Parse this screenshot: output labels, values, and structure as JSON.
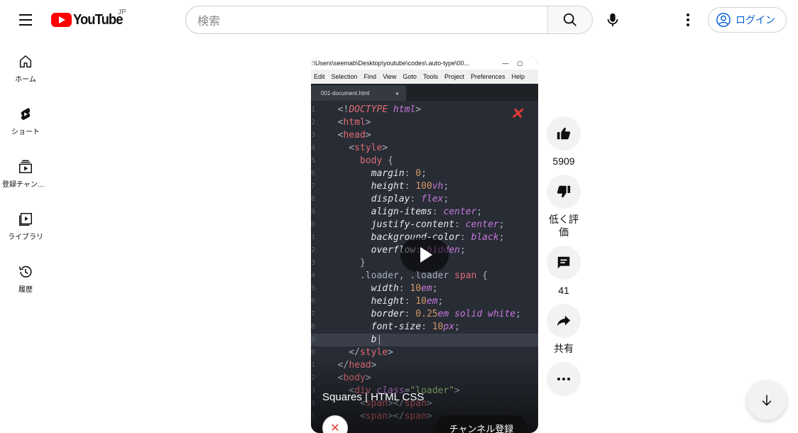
{
  "header": {
    "logo_text": "YouTube",
    "region": "JP",
    "search_placeholder": "検索",
    "login_label": "ログイン"
  },
  "sidebar": {
    "items": [
      {
        "label": "ホーム",
        "icon": "home-icon"
      },
      {
        "label": "ショート",
        "icon": "shorts-icon"
      },
      {
        "label": "登録チャンネル",
        "icon": "subscriptions-icon"
      },
      {
        "label": "ライブラリ",
        "icon": "library-icon"
      },
      {
        "label": "履歴",
        "icon": "history-icon"
      }
    ]
  },
  "video": {
    "title": "Squares | HTML CSS",
    "subscribe_label": "チャンネル登録",
    "editor": {
      "window_title": ":\\Users\\seemab\\Desktop\\youtube\\codes\\.auto-type\\00...",
      "menu": [
        "Edit",
        "Selection",
        "Find",
        "View",
        "Goto",
        "Tools",
        "Project",
        "Preferences",
        "Help"
      ],
      "tab_name": "001-document.html",
      "line_numbers": [
        "1",
        "2",
        "3",
        "4",
        "5",
        "6",
        "7",
        "8",
        "9",
        "0",
        "1",
        "2",
        "3",
        "4",
        "5",
        "6",
        "7",
        "8",
        "9",
        "0",
        "1",
        "2",
        "3",
        "4",
        "5"
      ]
    }
  },
  "actions": {
    "like_count": "5909",
    "dislike_label": "低く評価",
    "comment_count": "41",
    "share_label": "共有"
  }
}
